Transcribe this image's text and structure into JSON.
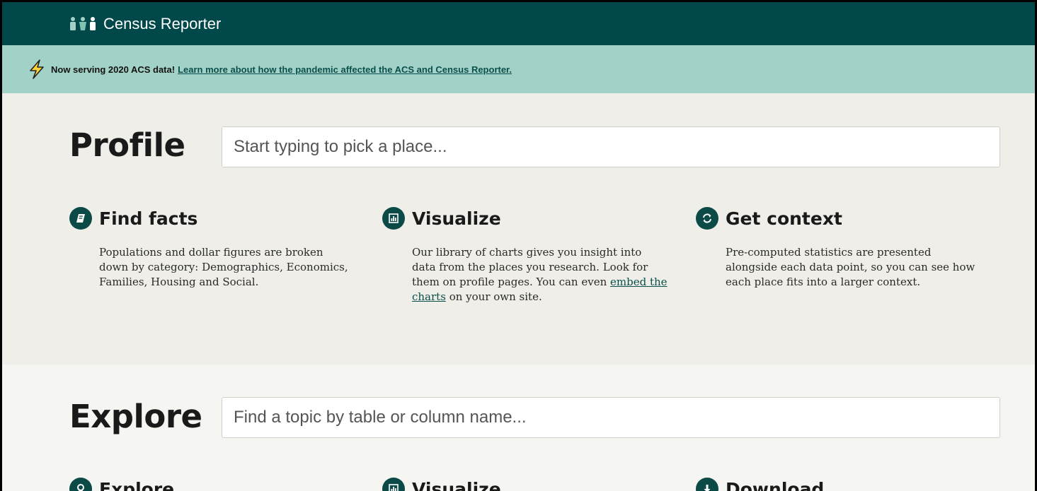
{
  "header": {
    "brand": "Census Reporter"
  },
  "announcement": {
    "lead": "Now serving 2020 ACS data!",
    "link": "Learn more about how the pandemic affected the ACS and Census Reporter."
  },
  "profile": {
    "title": "Profile",
    "search_placeholder": "Start typing to pick a place...",
    "features": [
      {
        "title": "Find facts",
        "icon": "book-icon",
        "text": "Populations and dollar figures are broken down by category: Demographics, Economics, Families, Housing and Social."
      },
      {
        "title": "Visualize",
        "icon": "bar-chart-icon",
        "text_before": "Our library of charts gives you insight into data from the places you research. Look for them on profile pages. You can even",
        "link": "embed the charts",
        "text_after": "on your own site."
      },
      {
        "title": "Get context",
        "icon": "refresh-icon",
        "text": "Pre-computed statistics are presented alongside each data point, so you can see how each place fits into a larger context."
      }
    ]
  },
  "explore": {
    "title": "Explore",
    "search_placeholder": "Find a topic by table or column name...",
    "features": [
      {
        "title": "Explore",
        "icon": "map-pin-icon"
      },
      {
        "title": "Visualize",
        "icon": "bar-chart-icon"
      },
      {
        "title": "Download",
        "icon": "download-icon"
      }
    ]
  },
  "colors": {
    "header_bg": "#00484a",
    "banner_bg": "#a2d2c7",
    "accent": "#0c4a48",
    "page_bg": "#efeee8"
  }
}
